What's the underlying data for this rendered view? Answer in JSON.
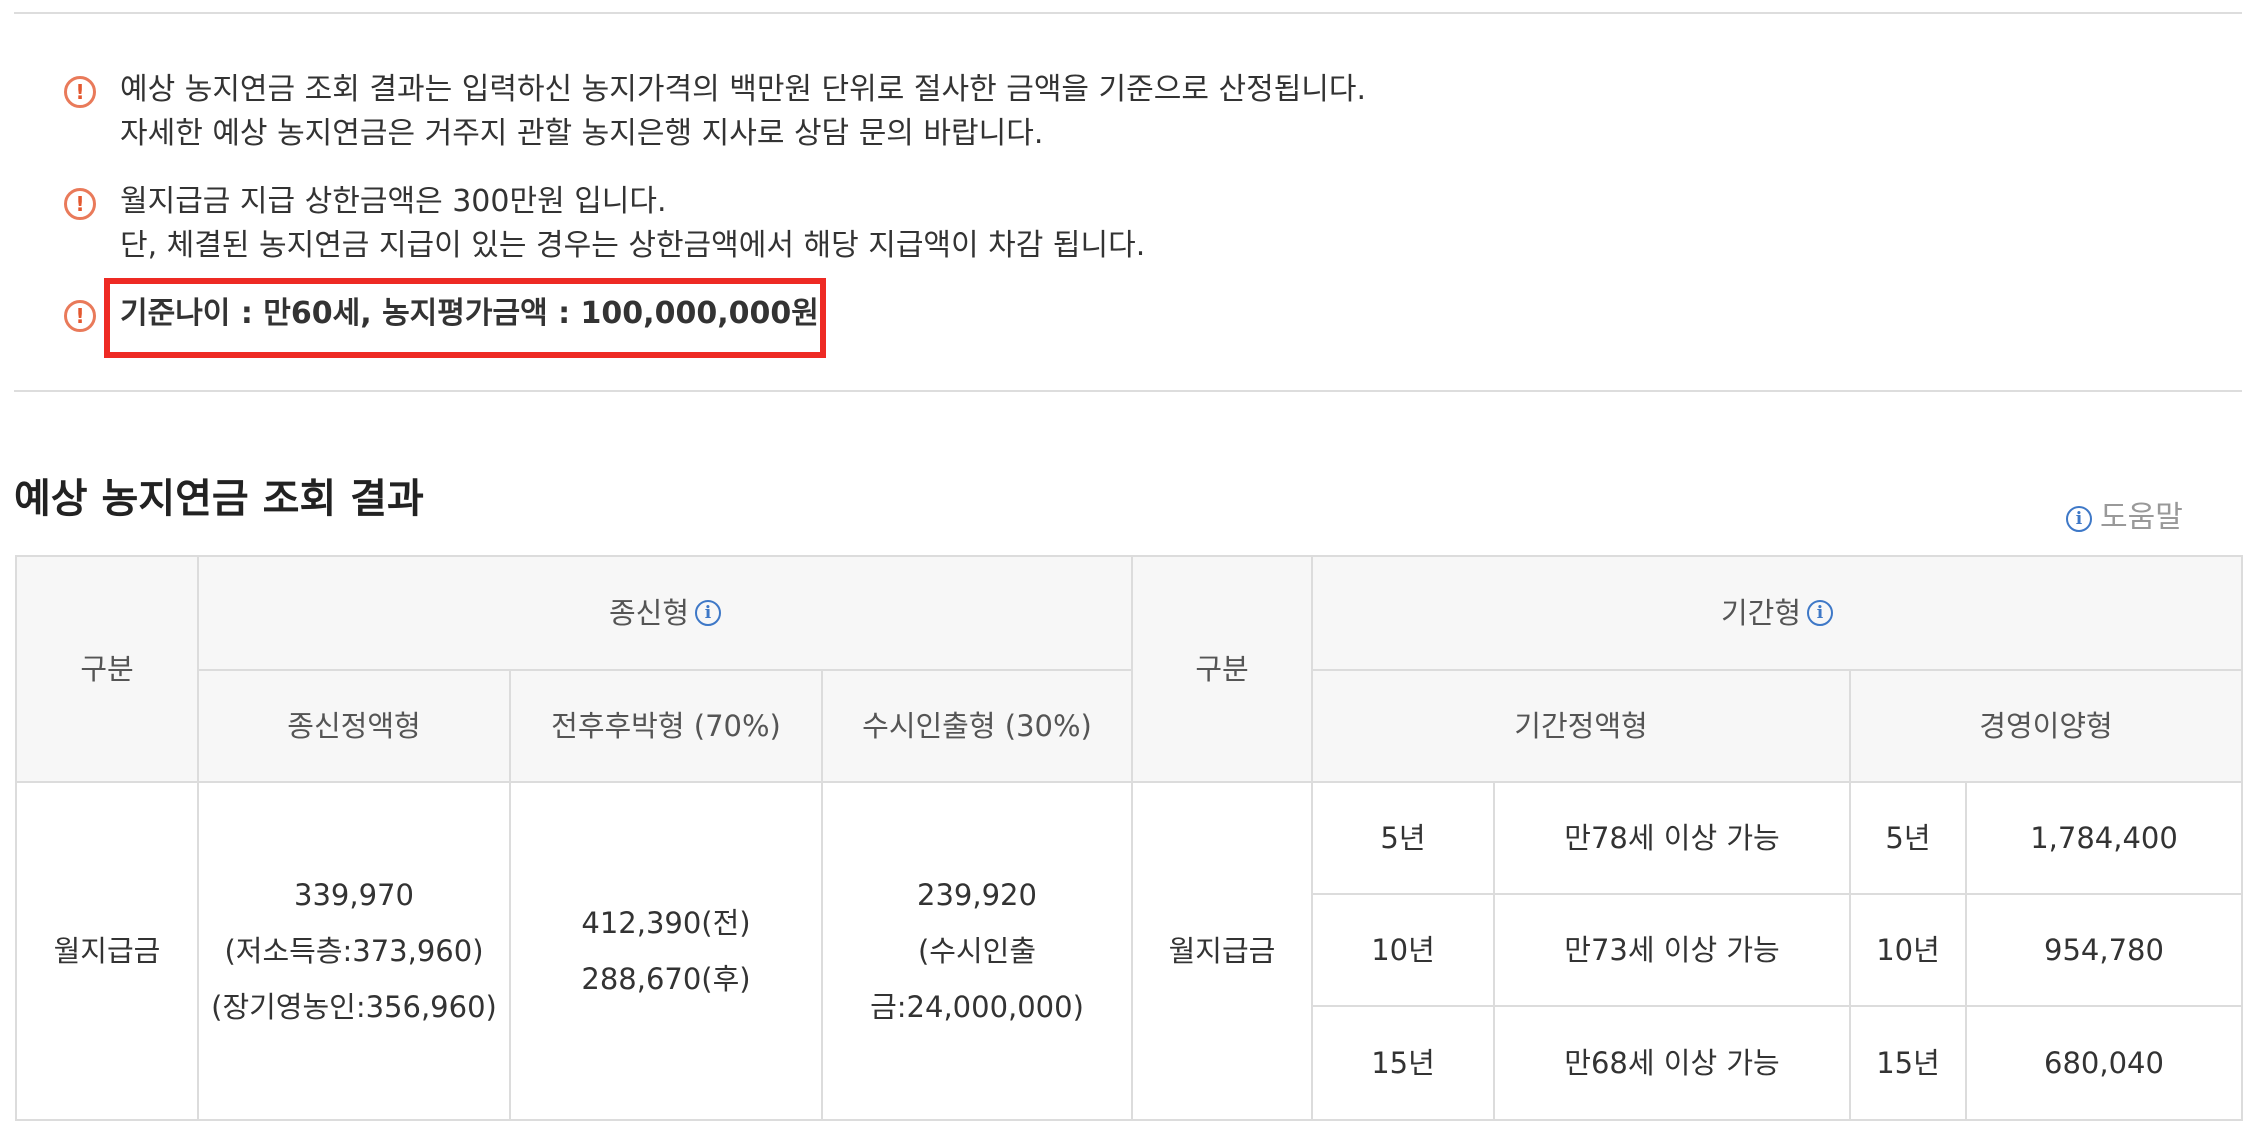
{
  "notices": [
    {
      "lines": [
        "예상 농지연금 조회 결과는 입력하신 농지가격의 백만원 단위로 절사한 금액을 기준으로 산정됩니다.",
        "자세한 예상 농지연금은 거주지 관할 농지은행 지사로 상담 문의 바랍니다."
      ]
    },
    {
      "lines": [
        "월지급금 지급 상한금액은 300만원 입니다.",
        "단, 체결된 농지연금 지급이 있는 경우는 상한금액에서 해당 지급액이 차감 됩니다."
      ]
    },
    {
      "lines": [
        "기준나이 : 만60세, 농지평가금액 : 100,000,000원"
      ]
    }
  ],
  "warn_icon_glyph": "!",
  "colors": {
    "warning": "#e4572e",
    "highlight": "#ee2a24",
    "info": "#3e78c7"
  },
  "section_title": "예상 농지연금 조회 결과",
  "help_link": {
    "icon": "info-circle-icon",
    "glyph": "i",
    "label": "도움말"
  },
  "table": {
    "left": {
      "category_header": "구분",
      "group_header": "종신형",
      "sub_headers": [
        "종신정액형",
        "전후후박형 (70%)",
        "수시인출형 (30%)"
      ],
      "row_label": "월지급금",
      "values": [
        [
          "339,970",
          "(저소득층:373,960)",
          "(장기영농인:356,960)"
        ],
        [
          "412,390(전)",
          "288,670(후)"
        ],
        [
          "239,920",
          "(수시인출",
          "금:24,000,000)"
        ]
      ]
    },
    "right": {
      "category_header": "구분",
      "group_header": "기간형",
      "sub_headers": [
        "기간정액형",
        "경영이양형"
      ],
      "row_label": "월지급금",
      "rows": [
        {
          "period": "5년",
          "fixed": "만78세 이상 가능",
          "transfer_period": "5년",
          "transfer_value": "1,784,400"
        },
        {
          "period": "10년",
          "fixed": "만73세 이상 가능",
          "transfer_period": "10년",
          "transfer_value": "954,780"
        },
        {
          "period": "15년",
          "fixed": "만68세 이상 가능",
          "transfer_period": "15년",
          "transfer_value": "680,040"
        }
      ]
    }
  }
}
